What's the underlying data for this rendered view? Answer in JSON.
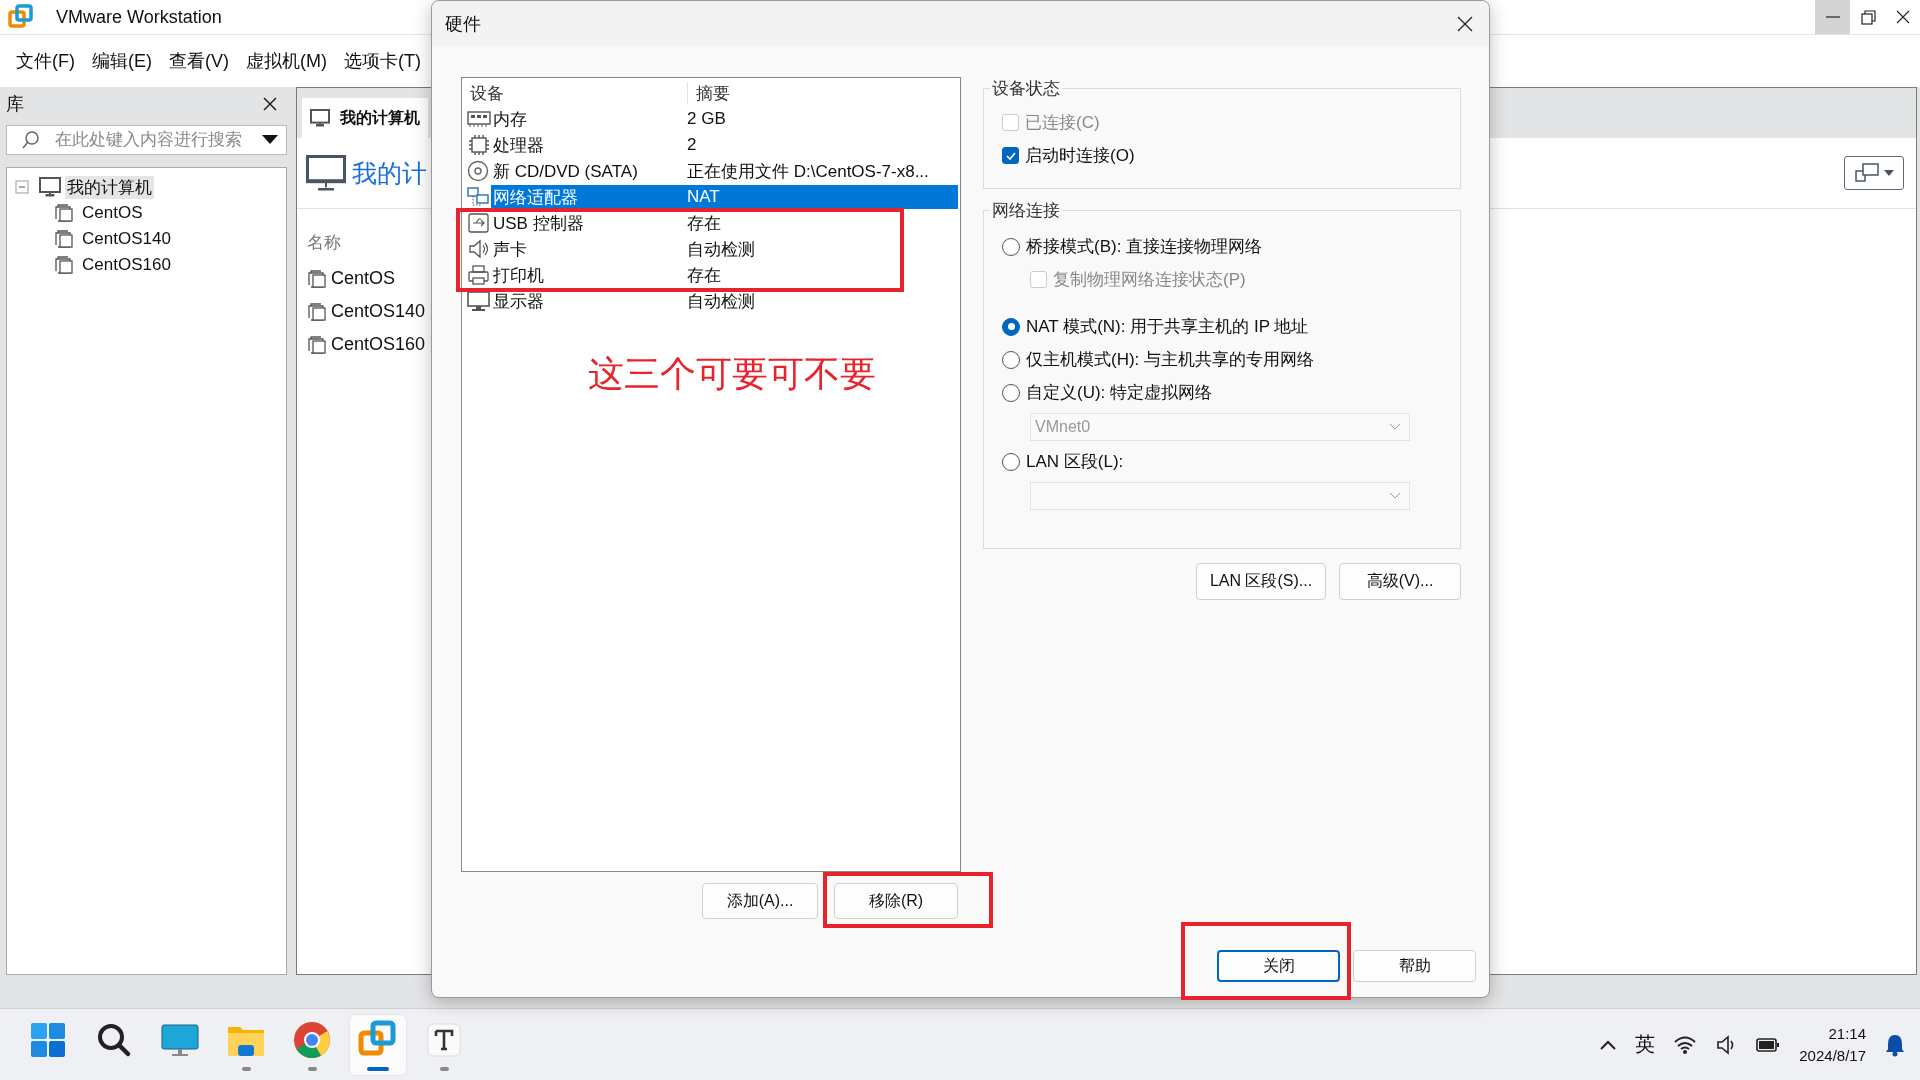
{
  "app": {
    "title": "VMware Workstation",
    "menu": [
      "文件(F)",
      "编辑(E)",
      "查看(V)",
      "虚拟机(M)",
      "选项卡(T)"
    ]
  },
  "library": {
    "title": "库",
    "search": {
      "placeholder": "在此处键入内容进行搜索"
    },
    "tree": [
      {
        "label": "我的计算机",
        "expanded": true,
        "selected": true,
        "children": [
          {
            "label": "CentOS",
            "selected": false
          },
          {
            "label": "CentOS140",
            "selected": false
          },
          {
            "label": "CentOS160",
            "selected": false
          }
        ]
      }
    ]
  },
  "home": {
    "tabs": [
      {
        "label": "我的计算机",
        "selected": true
      }
    ],
    "heading": "我的计",
    "column": "名称",
    "vms": [
      "CentOS",
      "CentOS140",
      "CentOS160"
    ]
  },
  "dialog": {
    "title": "硬件",
    "columns": [
      "设备",
      "摘要"
    ],
    "devices": [
      {
        "kind": "memory",
        "name": "内存",
        "summary": "2 GB",
        "selected": false
      },
      {
        "kind": "cpu",
        "name": "处理器",
        "summary": "2",
        "selected": false
      },
      {
        "kind": "disc",
        "name": "新 CD/DVD (SATA)",
        "summary": "正在使用文件 D:\\CentOS-7-x8...",
        "selected": false
      },
      {
        "kind": "network",
        "name": "网络适配器",
        "summary": "NAT",
        "selected": true
      },
      {
        "kind": "usb",
        "name": "USB 控制器",
        "summary": "存在",
        "selected": false
      },
      {
        "kind": "sound",
        "name": "声卡",
        "summary": "自动检测",
        "selected": false
      },
      {
        "kind": "printer",
        "name": "打印机",
        "summary": "存在",
        "selected": false
      },
      {
        "kind": "display",
        "name": "显示器",
        "summary": "自动检测",
        "selected": false
      }
    ],
    "note": "这三个可要可不要",
    "list_buttons": [
      "添加(A)...",
      "移除(R)"
    ],
    "device_status": {
      "title": "设备状态",
      "options": [
        {
          "kind": "checkbox",
          "label": "已连接(C)",
          "checked": false,
          "disabled": true
        },
        {
          "kind": "checkbox",
          "label": "启动时连接(O)",
          "checked": true,
          "disabled": false
        }
      ]
    },
    "network": {
      "title": "网络连接",
      "options": [
        {
          "kind": "radio",
          "label": "桥接模式(B): 直接连接物理网络",
          "selected": false
        },
        {
          "kind": "checkbox",
          "label": "复制物理网络连接状态(P)",
          "checked": false,
          "disabled": true
        },
        {
          "kind": "radio",
          "label": "NAT 模式(N): 用于共享主机的 IP 地址",
          "selected": true
        },
        {
          "kind": "radio",
          "label": "仅主机模式(H): 与主机共享的专用网络",
          "selected": false
        },
        {
          "kind": "radio",
          "label": "自定义(U): 特定虚拟网络",
          "selected": false
        },
        {
          "kind": "select",
          "value": "VMnet0",
          "disabled": true
        },
        {
          "kind": "radio",
          "label": "LAN 区段(L):",
          "selected": false
        },
        {
          "kind": "select",
          "disabled": true
        }
      ]
    },
    "side_buttons": [
      "LAN 区段(S)...",
      "高级(V)..."
    ],
    "footer_buttons": [
      {
        "label": "关闭",
        "default": true
      },
      {
        "label": "帮助",
        "default": false
      }
    ]
  },
  "taskbar": {
    "apps": [
      {
        "kind": "start",
        "running": false,
        "selected": false
      },
      {
        "kind": "search",
        "running": false,
        "selected": false
      },
      {
        "kind": "desktop",
        "running": false,
        "selected": false
      },
      {
        "kind": "folder",
        "running": true,
        "selected": false
      },
      {
        "kind": "browser",
        "running": true,
        "selected": false
      },
      {
        "kind": "vmware",
        "running": true,
        "selected": true
      },
      {
        "kind": "typora",
        "running": true,
        "selected": false
      }
    ],
    "tray": {
      "input_method": "英",
      "time": "21:14",
      "date": "2024/8/17"
    }
  }
}
